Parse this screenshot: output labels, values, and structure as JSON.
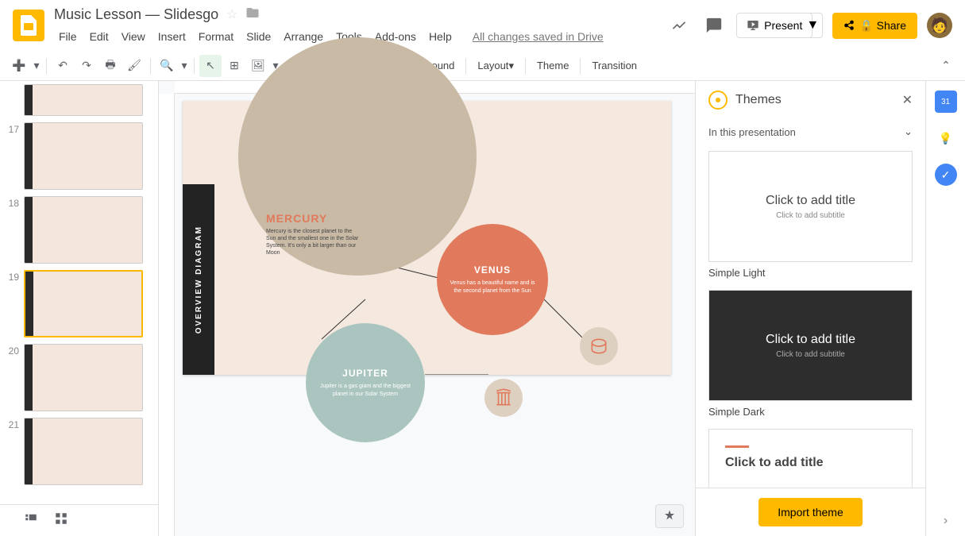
{
  "doc": {
    "title": "Music Lesson — Slidesgo"
  },
  "menu": {
    "file": "File",
    "edit": "Edit",
    "view": "View",
    "insert": "Insert",
    "format": "Format",
    "slide": "Slide",
    "arrange": "Arrange",
    "tools": "Tools",
    "addons": "Add-ons",
    "help": "Help",
    "saved": "All changes saved in Drive"
  },
  "header": {
    "present": "Present",
    "share": "Share"
  },
  "toolbar": {
    "background": "Background",
    "layout": "Layout",
    "theme": "Theme",
    "transition": "Transition"
  },
  "thumbs": [
    "17",
    "18",
    "19",
    "20",
    "21"
  ],
  "slide": {
    "sidebar_label": "OVERVIEW DIAGRAM",
    "mercury": {
      "title": "MERCURY",
      "text": "Mercury is the closest planet to the Sun and the smallest one in the Solar System. It's only a bit larger than our Moon"
    },
    "venus": {
      "title": "VENUS",
      "text": "Venus has a beautiful name and is the second planet from the Sun"
    },
    "jupiter": {
      "title": "JUPITER",
      "text": "Jupiter is a gas giant and the biggest planet in our Solar System"
    }
  },
  "themes": {
    "title": "Themes",
    "in_presentation": "In this presentation",
    "card_title": "Click to add title",
    "card_subtitle": "Click to add subtitle",
    "simple_light": "Simple Light",
    "simple_dark": "Simple Dark",
    "import": "Import theme"
  }
}
